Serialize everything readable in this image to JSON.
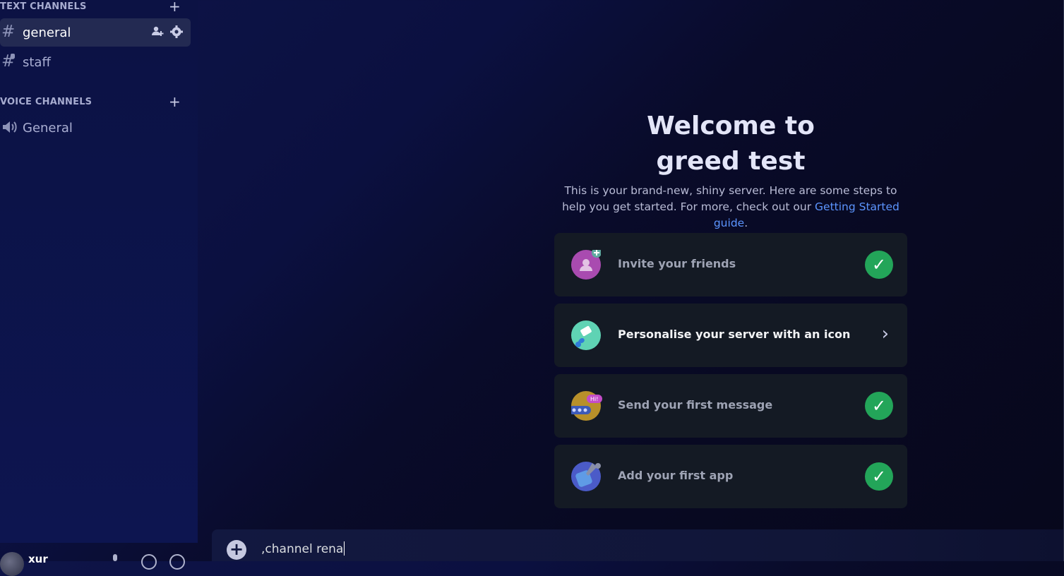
{
  "sidebar": {
    "text_category": "TEXT CHANNELS",
    "voice_category": "VOICE CHANNELS",
    "add_symbol": "+",
    "text_channels": [
      {
        "icon": "hash-icon",
        "label": "general",
        "selected": true
      },
      {
        "icon": "hash-lock-icon",
        "label": "staff",
        "selected": false
      }
    ],
    "voice_channels": [
      {
        "icon": "speaker-icon",
        "label": "General"
      }
    ]
  },
  "user": {
    "name": "xur"
  },
  "welcome": {
    "title_line1": "Welcome to",
    "title_line2": "greed test",
    "subtitle_part1": "This is your brand-new, shiny server. Here are some steps to help you get started. For more, check out our ",
    "link": "Getting Started guide",
    "subtitle_end": "."
  },
  "steps": [
    {
      "label": "Invite your friends",
      "done": true,
      "icon": "invite-friends-icon",
      "color": "#a94bb0"
    },
    {
      "label": "Personalise your server with an icon",
      "done": false,
      "icon": "paintbrush-icon",
      "color": "#5fd3b4"
    },
    {
      "label": "Send your first message",
      "done": true,
      "icon": "message-icon",
      "color": "#b8902a"
    },
    {
      "label": "Add your first app",
      "done": true,
      "icon": "app-icon",
      "color": "#4b5bc8"
    }
  ],
  "composer": {
    "value": ",channel rena"
  },
  "colors": {
    "accent_link": "#5c95ff",
    "check_green": "#23a559",
    "card_bg": "#141a24"
  }
}
